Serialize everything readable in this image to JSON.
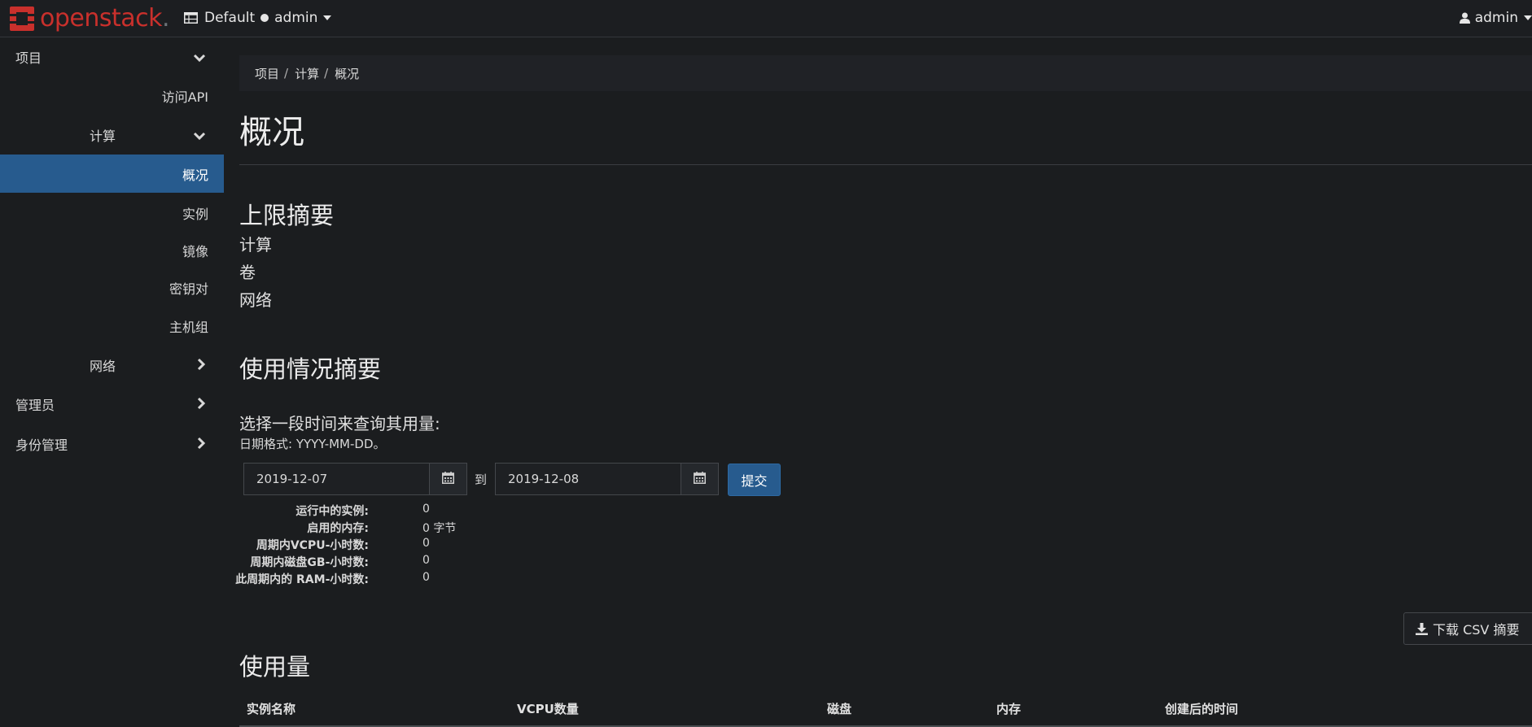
{
  "brand": {
    "name_main": "openstack",
    "name_dot": "."
  },
  "header": {
    "domain": "Default",
    "project": "admin",
    "user": "admin"
  },
  "sidebar": {
    "items": [
      {
        "label": "项目",
        "chevron": "down"
      },
      {
        "label": "访问API"
      },
      {
        "label": "计算",
        "chevron": "down"
      },
      {
        "label": "概况",
        "active": true
      },
      {
        "label": "实例"
      },
      {
        "label": "镜像"
      },
      {
        "label": "密钥对"
      },
      {
        "label": "主机组"
      },
      {
        "label": "网络",
        "chevron": "right"
      },
      {
        "label": "管理员",
        "chevron": "right"
      },
      {
        "label": "身份管理",
        "chevron": "right"
      }
    ]
  },
  "breadcrumb": {
    "items": [
      "项目",
      "计算",
      "概况"
    ],
    "separator": "/"
  },
  "page": {
    "title": "概况"
  },
  "limits": {
    "heading": "上限摘要",
    "lines": [
      "计算",
      "卷",
      "网络"
    ]
  },
  "usage_summary": {
    "heading": "使用情况摘要",
    "query_label": "选择一段时间来查询其用量:",
    "date_format": "日期格式: YYYY-MM-DD。",
    "start_date": "2019-12-07",
    "to_label": "到",
    "end_date": "2019-12-08",
    "submit_label": "提交",
    "stats": [
      {
        "key": "运行中的实例:",
        "value": "0"
      },
      {
        "key": "启用的内存:",
        "value": "0 字节"
      },
      {
        "key": "周期内VCPU-小时数:",
        "value": "0"
      },
      {
        "key": "周期内磁盘GB-小时数:",
        "value": "0"
      },
      {
        "key": "此周期内的 RAM-小时数:",
        "value": "0"
      }
    ]
  },
  "usage": {
    "heading": "使用量",
    "csv_label": "下载 CSV 摘要",
    "columns": [
      "实例名称",
      "VCPU数量",
      "磁盘",
      "内存",
      "创建后的时间"
    ]
  },
  "colors": {
    "accent": "#275b8e",
    "brand_red": "#c9302c",
    "background": "#1b1d1f"
  }
}
